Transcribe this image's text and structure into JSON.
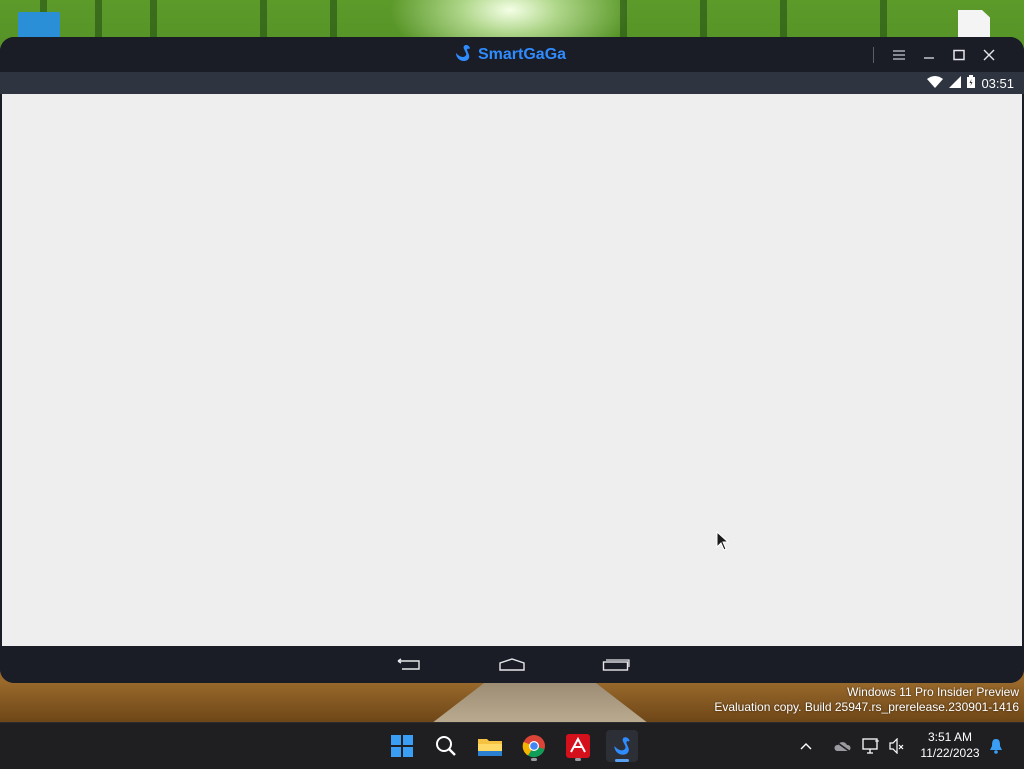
{
  "window": {
    "app_name": "SmartGaGa",
    "controls": {
      "menu": "menu-icon",
      "minimize": "minimize-icon",
      "maximize": "maximize-icon",
      "close": "close-icon"
    }
  },
  "android_status": {
    "time": "03:51",
    "icons": [
      "wifi-icon",
      "cellular-signal-icon",
      "battery-icon"
    ]
  },
  "android_nav": [
    "back-icon",
    "home-icon",
    "recents-icon"
  ],
  "watermark": {
    "line1": "Windows 11 Pro Insider Preview",
    "line2": "Evaluation copy. Build 25947.rs_prerelease.230901-1416"
  },
  "taskbar": {
    "apps": [
      "windows-start-icon",
      "search-icon",
      "file-explorer-icon",
      "chrome-icon",
      "acrobat-icon",
      "smartgaga-icon"
    ],
    "tray": [
      "chevron-up-icon",
      "onedrive-icon",
      "network-icon",
      "volume-muted-icon"
    ],
    "time": "3:51 AM",
    "date": "11/22/2023",
    "notification": "bell-icon"
  },
  "colors": {
    "brand": "#2f8cff",
    "screen_bg": "#eeeeee",
    "window_bg": "#1a1c26",
    "taskbar_bg": "#1f1f22"
  }
}
